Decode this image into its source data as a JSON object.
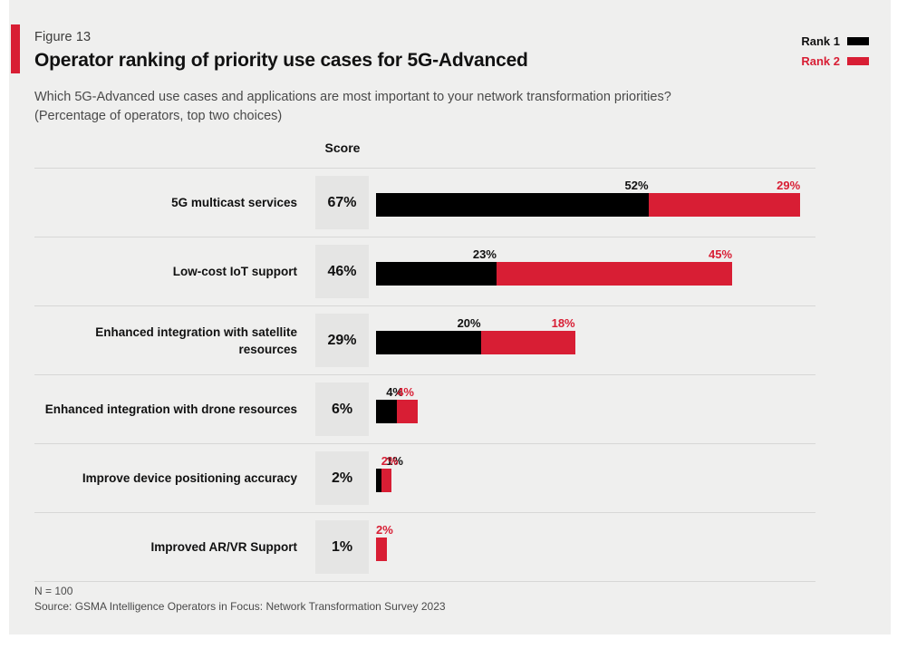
{
  "figure": {
    "number": "Figure 13",
    "title": "Operator ranking of priority use cases for 5G-Advanced",
    "subtitle": "Which 5G-Advanced use cases and applications are most important to your network transformation priorities? (Percentage of operators, top two choices)",
    "score_header": "Score",
    "note": "N = 100",
    "source": "Source: GSMA Intelligence Operators in Focus: Network Transformation Survey 2023"
  },
  "colors": {
    "rank1": "#000000",
    "rank2": "#d81e34",
    "panel_background": "#efefee",
    "score_box": "#e5e5e4",
    "separator": "#d7d7d6"
  },
  "legend": [
    {
      "label": "Rank 1",
      "color": "#000000"
    },
    {
      "label": "Rank 2",
      "color": "#d81e34"
    }
  ],
  "chart_data": {
    "type": "bar",
    "title": "Operator ranking of priority use cases for 5G-Advanced",
    "subtitle": "Which 5G-Advanced use cases and applications are most important to your network transformation priorities? (Percentage of operators, top two choices)",
    "xlabel": "",
    "ylabel": "",
    "orientation": "horizontal",
    "stacked": true,
    "grid": false,
    "legend_position": "top-right",
    "xlim": [
      0,
      81
    ],
    "categories": [
      "5G multicast services",
      "Low-cost IoT support",
      "Enhanced integration with satellite resources",
      "Enhanced integration with drone resources",
      "Improve device positioning accuracy",
      "Improved AR/VR Support"
    ],
    "series": [
      {
        "name": "Rank 1",
        "color": "#000000",
        "values": [
          52,
          23,
          20,
          4,
          1,
          0
        ]
      },
      {
        "name": "Rank 2",
        "color": "#d81e34",
        "values": [
          29,
          45,
          18,
          4,
          2,
          2
        ]
      }
    ],
    "score_column": {
      "header": "Score",
      "values": [
        "67%",
        "46%",
        "29%",
        "6%",
        "2%",
        "1%"
      ]
    },
    "data_labels": [
      {
        "rank1": "52%",
        "rank2": "29%"
      },
      {
        "rank1": "23%",
        "rank2": "45%"
      },
      {
        "rank1": "20%",
        "rank2": "18%"
      },
      {
        "rank1": "4%",
        "rank2": "4%"
      },
      {
        "rank1": "1%",
        "rank2": "2%"
      },
      {
        "rank1": "",
        "rank2": "2%"
      }
    ],
    "annotations": [
      "N = 100",
      "Source: GSMA Intelligence Operators in Focus: Network Transformation Survey 2023"
    ]
  }
}
